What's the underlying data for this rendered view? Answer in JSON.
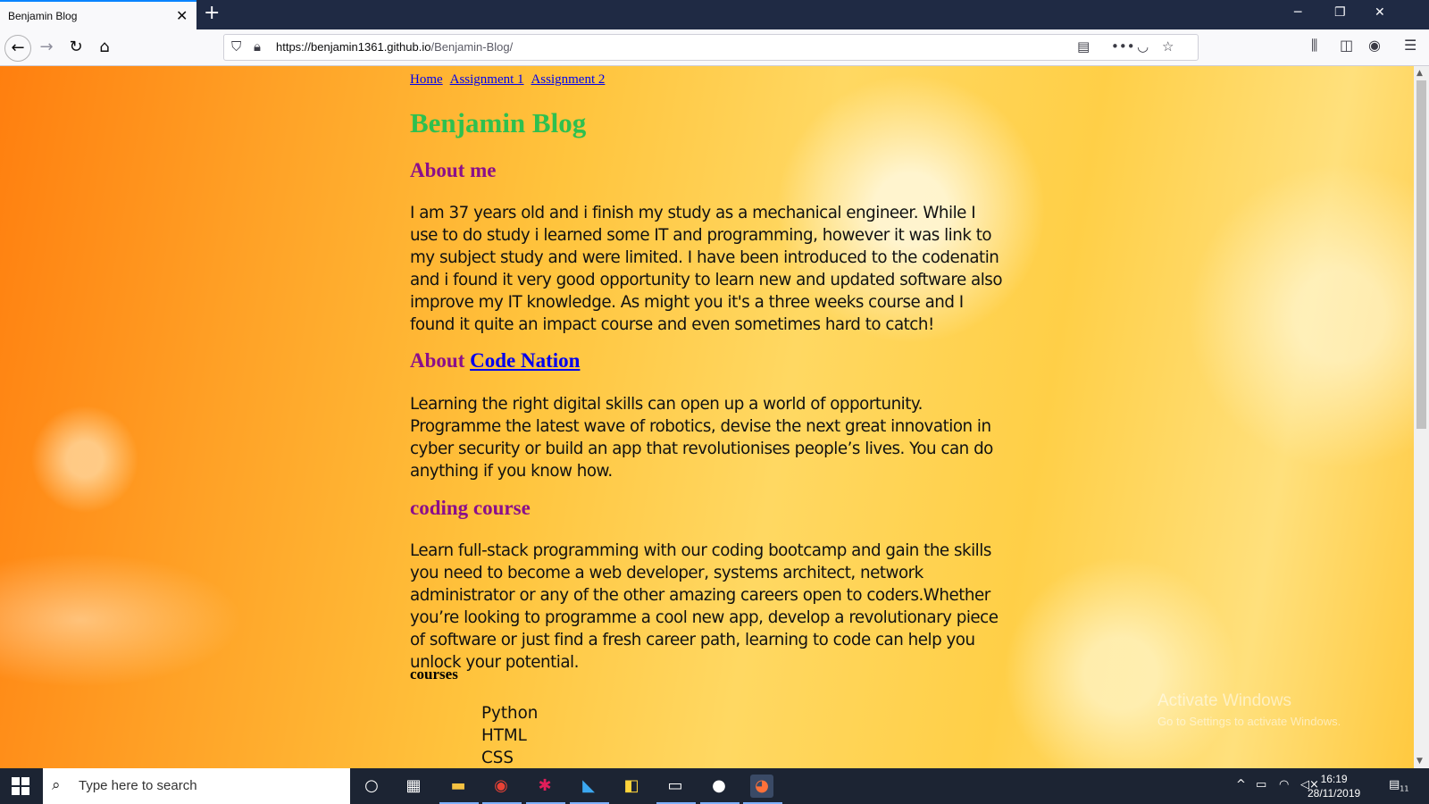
{
  "browser": {
    "tab_title": "Benjamin Blog",
    "url_domain": "https://benjamin1361.github.io",
    "url_path": "/Benjamin-Blog/"
  },
  "page": {
    "nav_links": [
      "Home",
      "Assignment 1",
      "Assignment 2"
    ],
    "title": "Benjamin Blog",
    "about_me_heading": "About me",
    "about_me_text": "I am 37 years old and i finish my study as a mechanical engineer. While I use to do study i learned some IT and programming, however it was link to my subject study and were limited. I have been introduced to the codenatin and i found it very good opportunity to learn new and updated software also improve my IT knowledge. As might you it's a three weeks course and I found it quite an impact course and even sometimes hard to catch!",
    "about_cn_prefix": "About",
    "about_cn_link": "Code Nation",
    "about_cn_text": "Learning the right digital skills can open up a world of opportunity. Programme the latest wave of robotics, devise the next great innovation in cyber security or build an app that revolutionises people’s lives. You can do anything if you know how.",
    "coding_heading": "coding course",
    "coding_text": "Learn full-stack programming with our coding bootcamp and gain the skills you need to become a web developer, systems architect, network administrator or any of the other amazing careers open to coders.Whether you’re looking to programme a cool new app, develop a revolutionary piece of software or just find a fresh career path, learning to code can help you unlock your potential.",
    "courses_heading": "courses",
    "courses": [
      "Python",
      "HTML",
      "CSS"
    ]
  },
  "watermark": {
    "line1": "Activate Windows",
    "line2": "Go to Settings to activate Windows."
  },
  "taskbar": {
    "search_placeholder": "Type here to search",
    "time": "16:19",
    "date": "28/11/2019",
    "notification_count": "11"
  }
}
